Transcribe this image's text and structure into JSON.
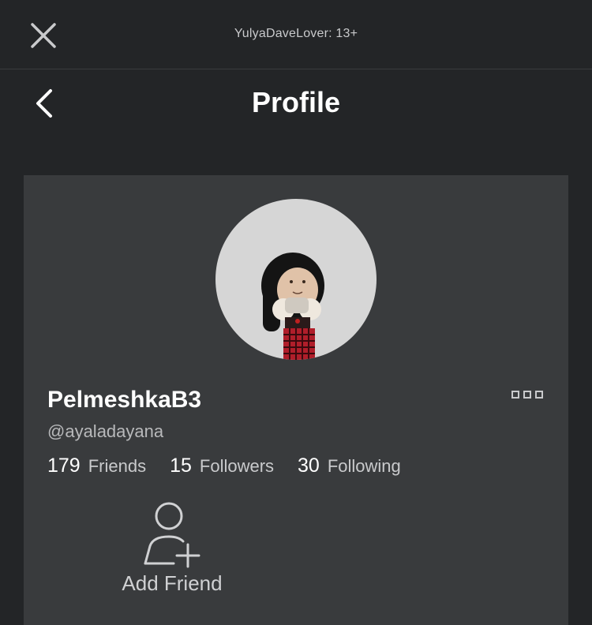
{
  "topbar": {
    "account_label": "YulyaDaveLover: 13+",
    "close_icon": "close-icon"
  },
  "header": {
    "title": "Profile",
    "back_icon": "chevron-left-icon"
  },
  "profile": {
    "display_name": "PelmeshkaB3",
    "username": "@ayaladayana",
    "more_icon": "more-dots-icon",
    "stats": [
      {
        "count": "179",
        "label": "Friends"
      },
      {
        "count": "15",
        "label": "Followers"
      },
      {
        "count": "30",
        "label": "Following"
      }
    ],
    "add_friend": {
      "label": "Add Friend",
      "icon": "add-friend-icon"
    }
  },
  "colors": {
    "background": "#232527",
    "card": "#393b3d",
    "avatar_bg": "#d6d6d6",
    "text_primary": "#ffffff",
    "text_secondary": "#b8b9bb"
  }
}
